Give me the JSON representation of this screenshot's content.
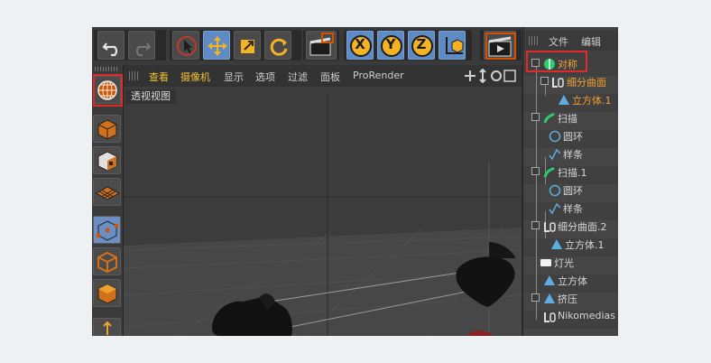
{
  "viewport": {
    "menu": {
      "view": "查看",
      "camera": "摄像机",
      "display": "显示",
      "options": "选项",
      "filter": "过滤",
      "panel": "面板",
      "prorender": "ProRender"
    },
    "label": "透视视图"
  },
  "object_manager": {
    "menu": {
      "file": "文件",
      "edit": "编辑"
    },
    "items": [
      {
        "label": "对称",
        "icon": "symmetry-icon"
      },
      {
        "label": "细分曲面",
        "icon": "subdivision-surface-icon"
      },
      {
        "label": "立方体.1",
        "icon": "cube-object-icon"
      },
      {
        "label": "扫描",
        "icon": "sweep-icon"
      },
      {
        "label": "圆环",
        "icon": "circle-spline-icon"
      },
      {
        "label": "样条",
        "icon": "spline-icon"
      },
      {
        "label": "扫描.1",
        "icon": "sweep-icon"
      },
      {
        "label": "圆环",
        "icon": "circle-spline-icon"
      },
      {
        "label": "样条",
        "icon": "spline-icon"
      },
      {
        "label": "细分曲面.2",
        "icon": "subdivision-surface-icon"
      },
      {
        "label": "立方体.1",
        "icon": "cube-object-icon"
      },
      {
        "label": "灯光",
        "icon": "light-icon"
      },
      {
        "label": "立方体",
        "icon": "cube-object-icon"
      },
      {
        "label": "挤压",
        "icon": "extrude-icon"
      },
      {
        "label": "Nikomedias",
        "icon": "subdivision-surface-icon"
      }
    ]
  },
  "toolbar": {
    "axis_x": "X",
    "axis_y": "Y",
    "axis_z": "Z"
  },
  "colors": {
    "accent_blue": "#5f8bc4",
    "highlight_orange": "#f0a030",
    "annotation_red": "#e02a2a"
  }
}
